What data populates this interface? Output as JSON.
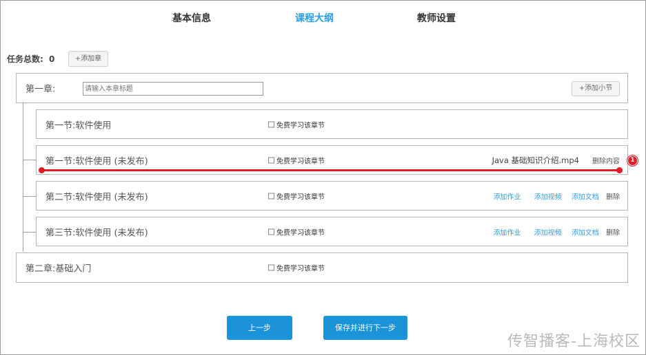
{
  "tabs": [
    {
      "label": "基本信息",
      "active": false
    },
    {
      "label": "课程大纲",
      "active": true
    },
    {
      "label": "教师设置",
      "active": false
    }
  ],
  "task_total": {
    "label": "任务总数:",
    "value": "0"
  },
  "add_chapter_label": "+添加章",
  "chapter1": {
    "label": "第一章:",
    "input_placeholder": "请输入本章标题",
    "add_section_label": "+添加小节"
  },
  "free_label": "免费学习该章节",
  "sections": [
    {
      "title": "第一节:软件使用"
    },
    {
      "title": "第一节:软件使用  (未发布)",
      "file": "Java 基础知识介绍.mp4",
      "delete_content": "删除内容"
    },
    {
      "title": "第二节:软件使用  (未发布)",
      "actions": [
        "添加作业",
        "添加视频",
        "添加文档",
        "删除"
      ]
    },
    {
      "title": "第三节:软件使用  (未发布)",
      "actions": [
        "添加作业",
        "添加视频",
        "添加文档",
        "删除"
      ]
    }
  ],
  "chapter2": {
    "label": "第二章:基础入门"
  },
  "buttons": {
    "prev": "上一步",
    "save_next": "保存并进行下一步"
  },
  "annotation": {
    "badge": "1",
    "color": "#e01b24"
  },
  "colors": {
    "accent": "#2b9fe8",
    "button": "#1a93d8"
  },
  "watermark": "传智播客-上海校区"
}
